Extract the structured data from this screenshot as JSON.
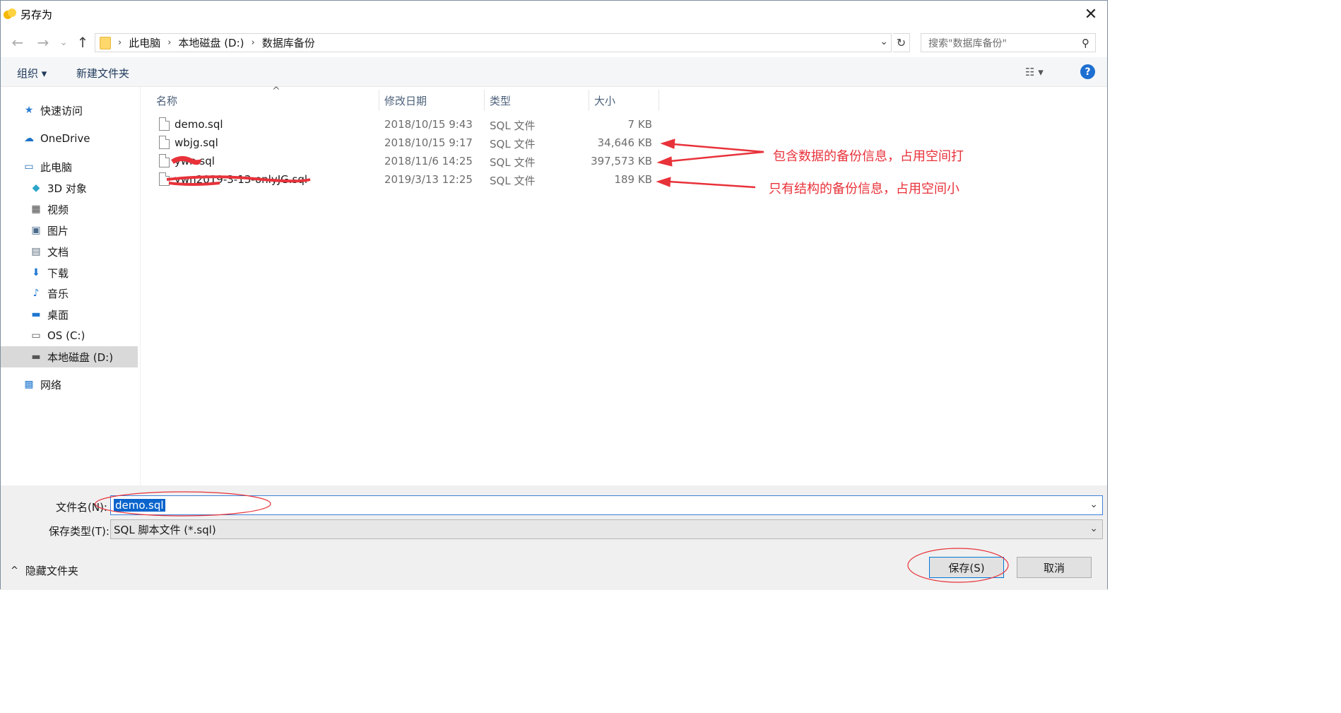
{
  "window": {
    "title": "另存为",
    "close_glyph": "✕"
  },
  "nav": {
    "back_glyph": "←",
    "forward_glyph": "→",
    "recent_glyph": "⌄",
    "up_glyph": "↑",
    "breadcrumb": [
      "此电脑",
      "本地磁盘 (D:)",
      "数据库备份"
    ],
    "breadcrumb_sep": "›",
    "dropdown_glyph": "⌄",
    "refresh_glyph": "↻",
    "search_placeholder": "搜索\"数据库备份\"",
    "search_glyph": "⚲"
  },
  "toolbar": {
    "organize_label": "组织 ▾",
    "new_folder_label": "新建文件夹",
    "view_label": "☷ ▾",
    "help_label": "?"
  },
  "sidebar": {
    "items": [
      {
        "label": "快速访问",
        "icon": "star-icon",
        "glyph": "★",
        "color": "#2d7fd3"
      },
      {
        "label": "OneDrive",
        "icon": "cloud-icon",
        "glyph": "☁",
        "color": "#1b72c9"
      },
      {
        "label": "此电脑",
        "icon": "computer-icon",
        "glyph": "▭",
        "color": "#1f6fb5"
      },
      {
        "label": "3D 对象",
        "icon": "cube-icon",
        "glyph": "◆",
        "color": "#2aa6c8"
      },
      {
        "label": "视频",
        "icon": "film-icon",
        "glyph": "▦",
        "color": "#444444"
      },
      {
        "label": "图片",
        "icon": "picture-icon",
        "glyph": "▣",
        "color": "#4a6b8a"
      },
      {
        "label": "文档",
        "icon": "document-icon",
        "glyph": "▤",
        "color": "#5a6a7a"
      },
      {
        "label": "下载",
        "icon": "download-icon",
        "glyph": "⬇",
        "color": "#1f78d1"
      },
      {
        "label": "音乐",
        "icon": "music-icon",
        "glyph": "♪",
        "color": "#1f78d1"
      },
      {
        "label": "桌面",
        "icon": "desktop-icon",
        "glyph": "▬",
        "color": "#1f78d1"
      },
      {
        "label": "OS (C:)",
        "icon": "drive-c-icon",
        "glyph": "▭",
        "color": "#555555"
      },
      {
        "label": "本地磁盘 (D:)",
        "icon": "drive-d-icon",
        "glyph": "▬",
        "color": "#555555"
      },
      {
        "label": "网络",
        "icon": "network-icon",
        "glyph": "▩",
        "color": "#2d7fd3"
      }
    ]
  },
  "columns": {
    "name": "名称",
    "modified": "修改日期",
    "type": "类型",
    "size": "大小",
    "sort_glyph": "^"
  },
  "files": [
    {
      "name": "demo.sql",
      "modified": "2018/10/15 9:43",
      "type": "SQL 文件",
      "size": "7 KB"
    },
    {
      "name": "wbjg.sql",
      "modified": "2018/10/15 9:17",
      "type": "SQL 文件",
      "size": "34,646 KB"
    },
    {
      "name": "ywn.sql",
      "modified": "2018/11/6 14:25",
      "type": "SQL 文件",
      "size": "397,573 KB"
    },
    {
      "name": "ywn2019-3-13-onlyJG.sql",
      "modified": "2019/3/13 12:25",
      "type": "SQL 文件",
      "size": "189 KB"
    }
  ],
  "annotations": {
    "large": "包含数据的备份信息，占用空间打",
    "small": "只有结构的备份信息，占用空间小",
    "color": "#e8323a"
  },
  "form": {
    "filename_label": "文件名(N):",
    "filename_value": "demo.sql",
    "filetype_label": "保存类型(T):",
    "filetype_value": "SQL 脚本文件 (*.sql)",
    "dropdown_glyph": "⌄"
  },
  "footer": {
    "hide_folders_label": "隐藏文件夹",
    "hide_folders_glyph": "^",
    "save_label": "保存(S)",
    "cancel_label": "取消"
  }
}
